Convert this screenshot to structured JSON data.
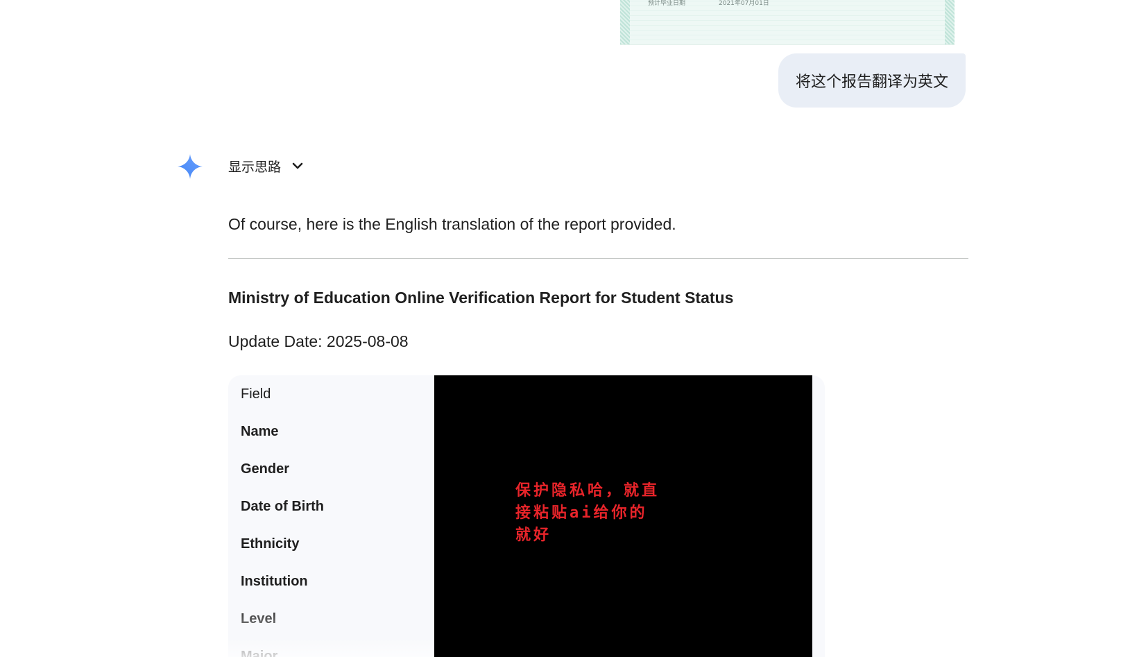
{
  "conversation": {
    "attachment": {
      "fragment_text_a": "预计毕业日期",
      "fragment_text_b": "2021年07月01日"
    },
    "user_message": "将这个报告翻译为英文",
    "assistant": {
      "thinking_toggle_label": "显示思路",
      "intro": "Of course, here is the English translation of the report provided.",
      "report_title": "Ministry of Education Online Verification Report for Student Status",
      "update_date": "Update Date: 2025-08-08",
      "table": {
        "header": "Field",
        "rows": [
          "Name",
          "Gender",
          "Date of Birth",
          "Ethnicity",
          "Institution",
          "Level",
          "Major"
        ]
      },
      "redaction_note": "保护隐私哈，就直接粘贴ai给你的就好"
    }
  },
  "colors": {
    "user_bubble": "#e9eef6",
    "redaction_bg": "#000000",
    "redaction_text": "#e8242a",
    "table_bg": "#f8f9fc",
    "spark_gradient_start": "#4285f4",
    "spark_gradient_end": "#9b72cb"
  },
  "icons": {
    "assistant_avatar": "gemini-sparkle-icon",
    "expand": "chevron-down-icon"
  }
}
